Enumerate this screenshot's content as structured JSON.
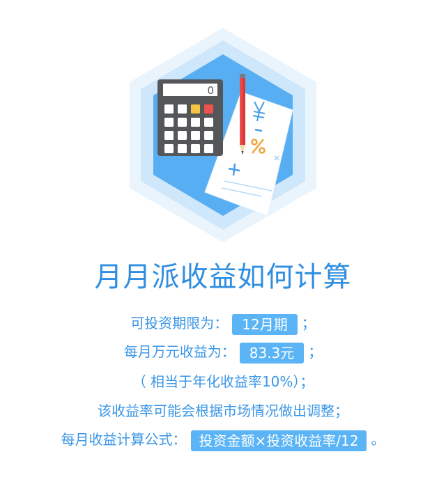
{
  "illustration": {
    "calculator_display": "0",
    "paper_marks": [
      "¥",
      "−",
      "%",
      "+",
      "×"
    ],
    "icons": [
      "hexagon-badge",
      "calculator-icon",
      "pencil-icon",
      "paper-sheet"
    ]
  },
  "title": "月月派收益如何计算",
  "lines": {
    "period": {
      "prefix": "可投资期限为：",
      "value": "12月期",
      "suffix": "；"
    },
    "monthly": {
      "prefix": "每月万元收益为：",
      "value": "83.3元",
      "suffix": "；"
    },
    "annual": {
      "text": "（ 相当于年化收益率10%）；"
    },
    "adjust": {
      "text": "该收益率可能会根据市场情况做出调整；"
    },
    "formula": {
      "prefix": "每月收益计算公式：",
      "value": "投资金额×投资收益率/12",
      "suffix": "。"
    }
  },
  "colors": {
    "title": "#2f8ee0",
    "text": "#3a96e6",
    "pill": "#5ab4f5",
    "hex_outer": "#eaf4fd",
    "hex_mid": "#cfe7fb",
    "hex_inner": "#58aef3",
    "calculator_body": "#54565a",
    "key_yellow": "#f5c542",
    "key_red": "#ef5350",
    "pencil": "#ef4a4a",
    "paper_mark": "#4a9de8"
  }
}
